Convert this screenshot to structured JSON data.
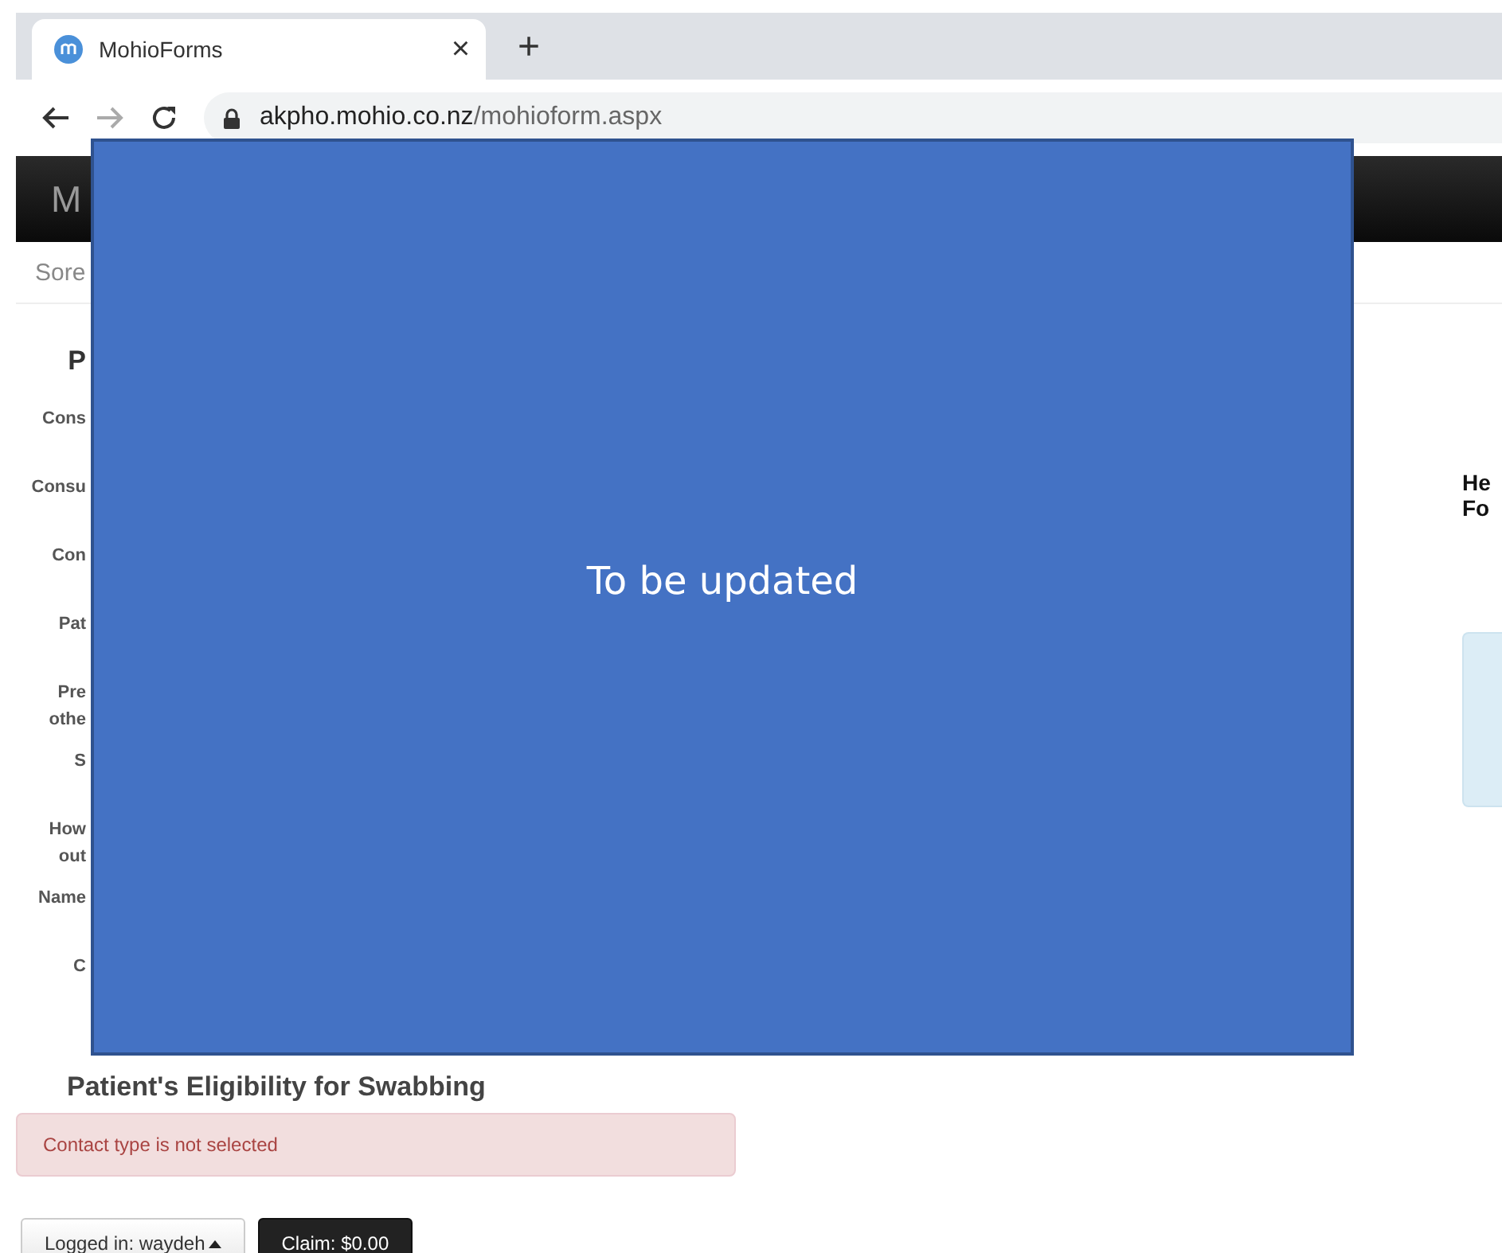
{
  "browser": {
    "tab": {
      "title": "MohioForms",
      "close": "×"
    },
    "new_tab": "+",
    "url": {
      "host": "akpho.mohio.co.nz",
      "path": "/mohioform.aspx"
    }
  },
  "header": {
    "brand": "M"
  },
  "breadcrumb": "Sore",
  "section_title": "P",
  "fields": [
    {
      "label": "Cons"
    },
    {
      "label": "Consu"
    },
    {
      "label": "Con"
    },
    {
      "label": "Pat"
    },
    {
      "label": "Pre\nothe"
    },
    {
      "label": "S"
    },
    {
      "label": "How\nout"
    },
    {
      "label": "Name"
    },
    {
      "label": "C"
    }
  ],
  "overlay": {
    "text": "To be updated"
  },
  "side_heading": "He\nFo",
  "eligibility_title": "Patient's Eligibility for Swabbing",
  "alert": "Contact type is not selected",
  "footer": {
    "user": "Logged in: waydeh",
    "claim": "Claim: $0.00"
  }
}
